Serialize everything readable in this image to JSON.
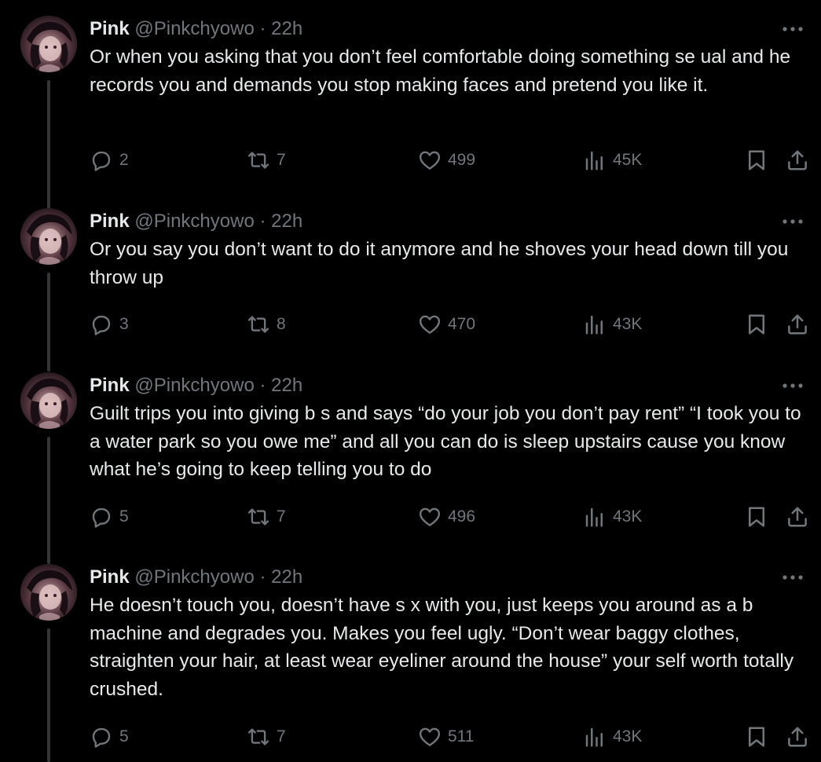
{
  "colors": {
    "background": "#000000",
    "text_primary": "#e7e9ea",
    "text_secondary": "#71767b",
    "thread_line": "#333639"
  },
  "icons": {
    "reply": "reply-icon",
    "retweet": "retweet-icon",
    "like": "heart-icon",
    "views": "views-icon",
    "bookmark": "bookmark-icon",
    "share": "share-icon",
    "more": "more-icon"
  },
  "tweets": [
    {
      "name": "Pink",
      "handle": "@Pinkchyowo",
      "dot": "·",
      "time": "22h",
      "text": "Or when you asking that you don’t feel comfortable doing something se ual and he records you and demands you stop making faces and pretend you like it.",
      "replies": "2",
      "retweets": "7",
      "likes": "499",
      "views": "45K"
    },
    {
      "name": "Pink",
      "handle": "@Pinkchyowo",
      "dot": "·",
      "time": "22h",
      "text": "Or you say you don’t want to do it anymore and he shoves your head down till you throw up",
      "replies": "3",
      "retweets": "8",
      "likes": "470",
      "views": "43K"
    },
    {
      "name": "Pink",
      "handle": "@Pinkchyowo",
      "dot": "·",
      "time": "22h",
      "text": "Guilt trips you into giving b s and says “do your job you don’t pay rent” “I took you to a water park so you owe me” and all you can do is sleep upstairs cause you know what he’s going to keep telling you to do",
      "replies": "5",
      "retweets": "7",
      "likes": "496",
      "views": "43K"
    },
    {
      "name": "Pink",
      "handle": "@Pinkchyowo",
      "dot": "·",
      "time": "22h",
      "text": "He doesn’t touch you, doesn’t have s x with you, just keeps you around as a b machine and degrades you. Makes you feel ugly. “Don’t wear baggy clothes, straighten your hair, at least wear eyeliner around the house” your self worth totally crushed.",
      "replies": "5",
      "retweets": "7",
      "likes": "511",
      "views": "43K"
    }
  ]
}
